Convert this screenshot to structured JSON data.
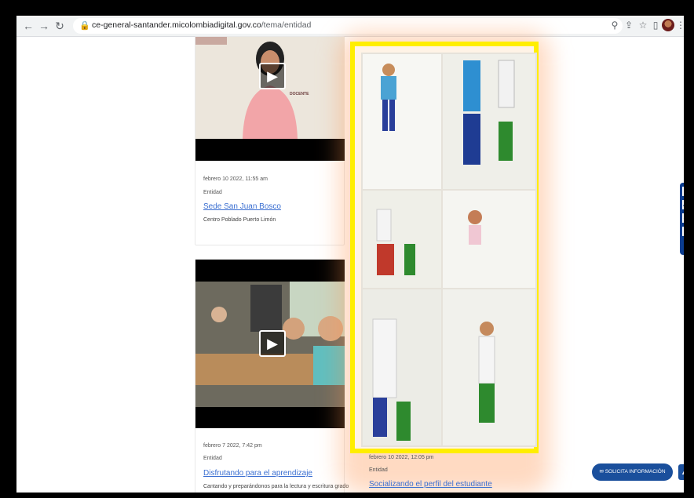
{
  "browser": {
    "back_icon": "arrow-left-icon",
    "forward_icon": "arrow-right-icon",
    "reload_icon": "reload-icon",
    "url_domain": "ce-general-santander.micolombiadigital.gov.co",
    "url_path": "/tema/entidad",
    "toolbar_icons": [
      "zoom-icon",
      "share-icon",
      "star-icon",
      "tab-icon",
      "profile-avatar",
      "menu-icon"
    ]
  },
  "posts": [
    {
      "date": "febrero 10 2022, 11:55 am",
      "type": "Entidad",
      "title": "Sede San Juan Bosco",
      "desc": "Centro Poblado Puerto Limón",
      "shirt_text": "DOCENTE"
    },
    {
      "date": "febrero 7 2022, 7:42 pm",
      "type": "Entidad",
      "title": "Disfrutando para el aprendizaje",
      "desc": "Cantando y preparándonos para la lectura y escritura grado"
    },
    {
      "date": "febrero 10 2022, 12:05 pm",
      "type": "Entidad",
      "title": "Socializando el perfil del estudiante"
    }
  ],
  "accessibility_labels": [
    "◐",
    "A⁺",
    "a⁻",
    "⤢"
  ],
  "cta_label": "SOLICITA INFORMACIÓN",
  "colors": {
    "highlight": "#ffee00",
    "link": "#3b6fd1",
    "cta": "#1a4f9c"
  }
}
